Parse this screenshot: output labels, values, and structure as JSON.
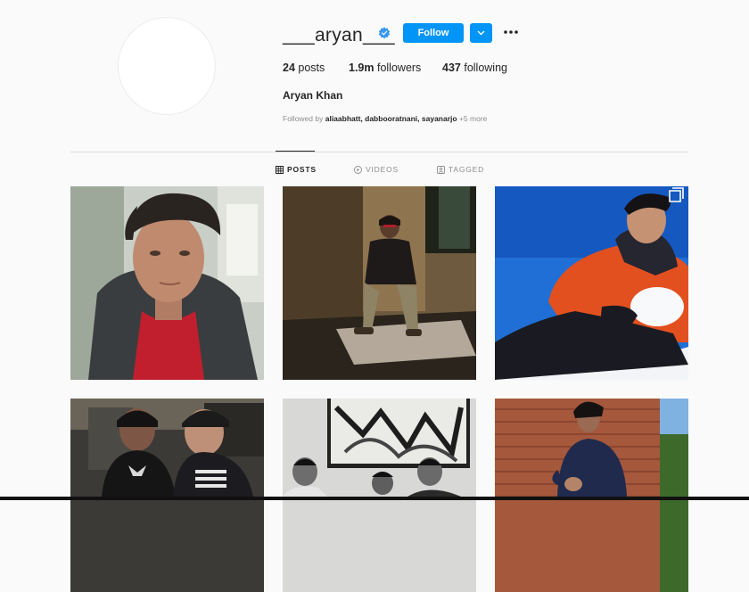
{
  "profile": {
    "username": "___aryan___",
    "verified": true,
    "follow_label": "Follow",
    "full_name": "Aryan Khan",
    "stats": {
      "posts_count": "24",
      "posts_label": "posts",
      "followers_count": "1.9m",
      "followers_label": "followers",
      "following_count": "437",
      "following_label": "following"
    },
    "followed_by": {
      "prefix": "Followed by",
      "users": "aliaabhatt, dabbooratnani, sayanarjo",
      "more": "+5 more"
    }
  },
  "tabs": [
    {
      "label": "POSTS",
      "icon": "grid-icon",
      "active": true
    },
    {
      "label": "VIDEOS",
      "icon": "play-icon",
      "active": false
    },
    {
      "label": "TAGGED",
      "icon": "tag-icon",
      "active": false
    }
  ],
  "colors": {
    "accent": "#0095f6",
    "verified": "#3897f0",
    "background": "#fafafa",
    "divider": "#dbdbdb"
  },
  "posts": [
    {
      "subject": "portrait-red-shirt"
    },
    {
      "subject": "seated-in-shadow"
    },
    {
      "subject": "snow-orange-jacket",
      "multi": true
    },
    {
      "subject": "two-friends-hoodies"
    },
    {
      "subject": "group-under-painting"
    },
    {
      "subject": "brick-wall-sweater"
    }
  ]
}
